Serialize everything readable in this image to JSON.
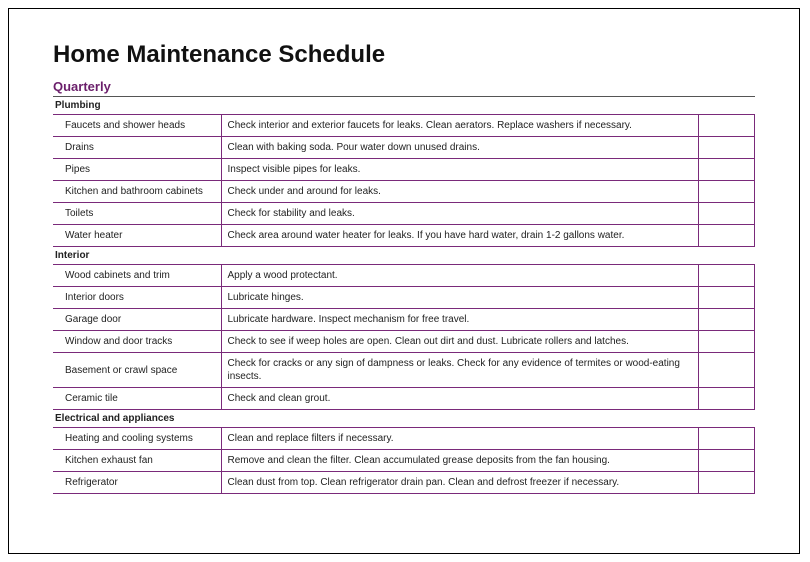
{
  "title": "Home Maintenance Schedule",
  "period": "Quarterly",
  "sections": [
    {
      "name": "Plumbing",
      "items": [
        {
          "item": "Faucets and shower heads",
          "task": "Check interior and exterior faucets for leaks. Clean aerators. Replace washers if necessary."
        },
        {
          "item": "Drains",
          "task": "Clean with baking soda. Pour water down unused drains."
        },
        {
          "item": "Pipes",
          "task": "Inspect visible pipes for leaks."
        },
        {
          "item": "Kitchen and bathroom cabinets",
          "task": "Check under and around for leaks."
        },
        {
          "item": "Toilets",
          "task": "Check for stability and leaks."
        },
        {
          "item": "Water heater",
          "task": "Check area around water heater for leaks. If you have hard water, drain 1-2 gallons water."
        }
      ]
    },
    {
      "name": "Interior",
      "items": [
        {
          "item": "Wood cabinets and trim",
          "task": "Apply a wood protectant."
        },
        {
          "item": "Interior doors",
          "task": "Lubricate hinges."
        },
        {
          "item": "Garage door",
          "task": "Lubricate hardware. Inspect mechanism for free travel."
        },
        {
          "item": "Window and door tracks",
          "task": "Check to see if weep holes are open. Clean out dirt and dust. Lubricate rollers and latches."
        },
        {
          "item": "Basement or crawl space",
          "task": "Check for cracks or any sign of dampness or leaks. Check for any evidence of termites or wood-eating insects.",
          "tall": true
        },
        {
          "item": "Ceramic tile",
          "task": "Check and clean grout."
        }
      ]
    },
    {
      "name": "Electrical and appliances",
      "items": [
        {
          "item": "Heating and cooling systems",
          "task": "Clean and replace filters if necessary."
        },
        {
          "item": "Kitchen exhaust fan",
          "task": "Remove and clean the filter. Clean accumulated grease deposits from the fan housing."
        },
        {
          "item": "Refrigerator",
          "task": "Clean dust from top. Clean refrigerator drain pan. Clean and defrost freezer if necessary."
        }
      ]
    }
  ]
}
